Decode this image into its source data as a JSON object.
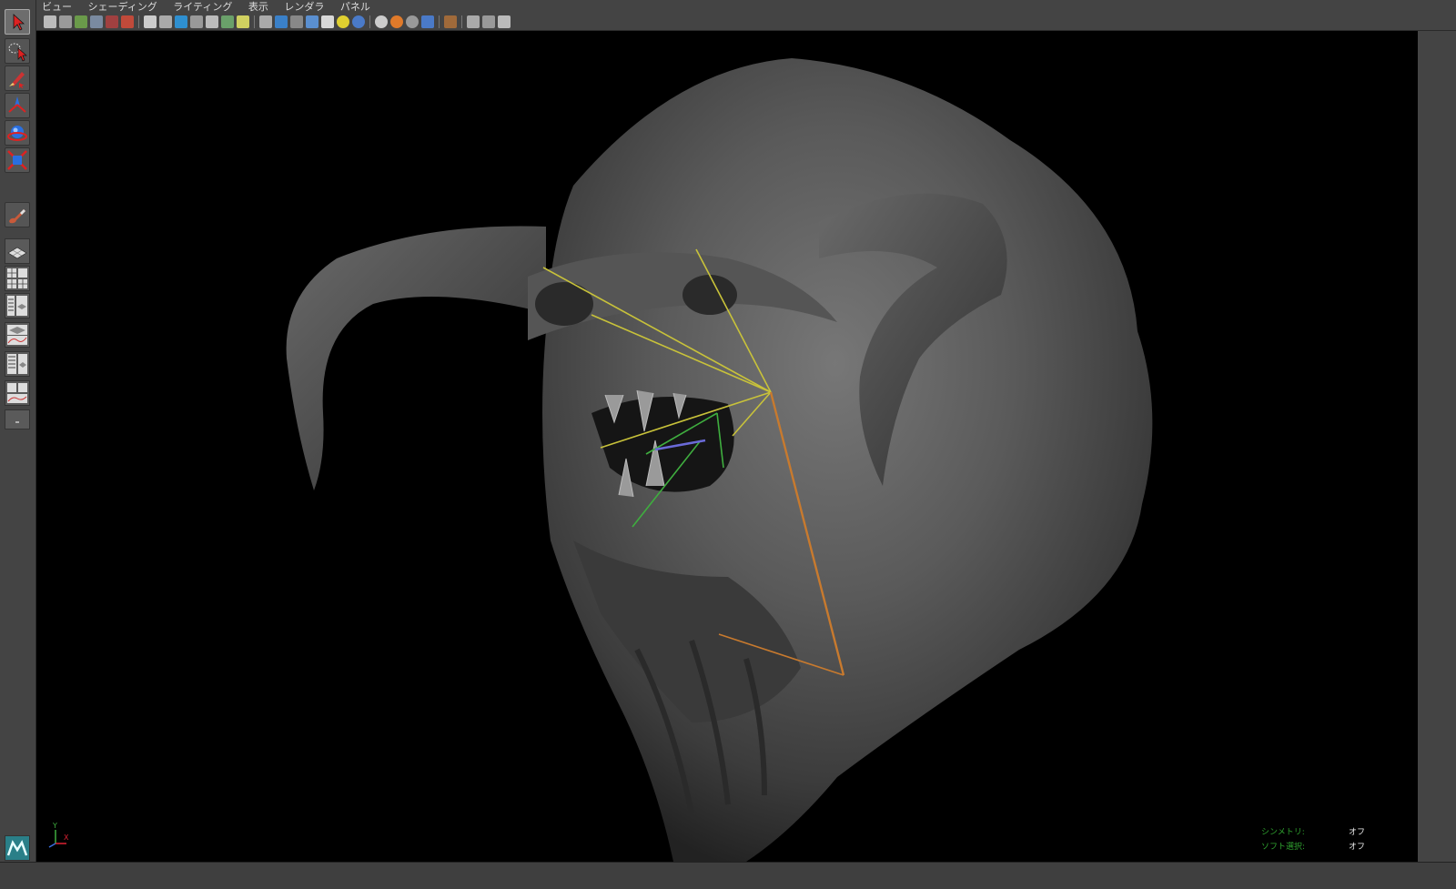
{
  "menubar": {
    "view": "ビュー",
    "shading": "シェーディング",
    "lighting": "ライティング",
    "show": "表示",
    "renderer": "レンダラ",
    "panels": "パネル"
  },
  "icons": {
    "select_tool": "select-arrow-icon",
    "lasso_tool": "lasso-select-icon",
    "paint_select_tool": "paint-select-icon",
    "move_tool": "move-icon",
    "rotate_tool": "rotate-icon",
    "scale_tool": "scale-icon",
    "last_tool": "brush-icon",
    "app_logo": "maya-logo-icon"
  },
  "hud": {
    "symmetry_label": "シンメトリ:",
    "symmetry_value": "オフ",
    "soft_select_label": "ソフト選択:",
    "soft_select_value": "オフ"
  },
  "axis": {
    "y": "Y",
    "x": "X"
  },
  "colors": {
    "background": "#444444",
    "viewport": "#000000",
    "hud_label": "#2fa12f",
    "hud_value": "#eaeaea",
    "joint_yellow": "#c8c23a",
    "joint_orange": "#c87a2e",
    "joint_green": "#3fae3f"
  }
}
